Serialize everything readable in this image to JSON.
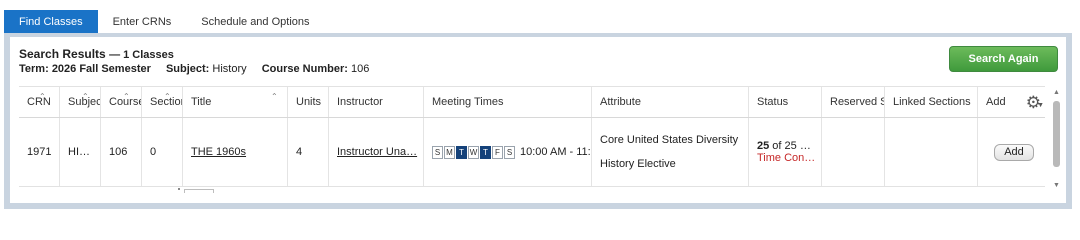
{
  "tabs": [
    {
      "label": "Find Classes",
      "active": true
    },
    {
      "label": "Enter CRNs",
      "active": false
    },
    {
      "label": "Schedule and Options",
      "active": false
    }
  ],
  "results": {
    "title": "Search Results",
    "count": "— 1 Classes",
    "term_label": "Term:",
    "term_value": "2026 Fall Semester",
    "subject_label": "Subject:",
    "subject_value": "History",
    "course_label": "Course Number:",
    "course_value": "106"
  },
  "search_again_label": "Search Again",
  "columns": {
    "crn": "CRN",
    "subject": "Subject",
    "course": "Course",
    "section": "Section",
    "title": "Title",
    "units": "Units",
    "instructor": "Instructor",
    "meeting": "Meeting Times",
    "attribute": "Attribute",
    "status": "Status",
    "reserved": "Reserved S",
    "linked": "Linked Sections",
    "add": "Add"
  },
  "row": {
    "crn": "1971",
    "subject": "HI…",
    "course": "106",
    "section": "0",
    "title": "THE 1960s",
    "units": "4",
    "instructor": "Instructor Una…",
    "days": [
      {
        "label": "S",
        "on": false
      },
      {
        "label": "M",
        "on": false
      },
      {
        "label": "T",
        "on": true
      },
      {
        "label": "W",
        "on": false
      },
      {
        "label": "T",
        "on": true
      },
      {
        "label": "F",
        "on": false
      },
      {
        "label": "S",
        "on": false
      }
    ],
    "time": "10:00 AM - 11:",
    "attributes": [
      "Core United States Diversity",
      "History Elective"
    ],
    "status_seats": "25",
    "status_of": " of 25 …",
    "status_conflict": "Time Con…",
    "add_label": "Add"
  },
  "icons": {
    "settings": "gear-icon",
    "sort": "sort-arrows-icon",
    "scroll_up": "chevron-up-icon",
    "scroll_down": "chevron-down-icon"
  },
  "colors": {
    "tab_active": "#1a73c7",
    "search_again": "#4ea648",
    "day_selected": "#15427a",
    "conflict_text": "#c62828",
    "panel_border": "#c9d4e0"
  }
}
